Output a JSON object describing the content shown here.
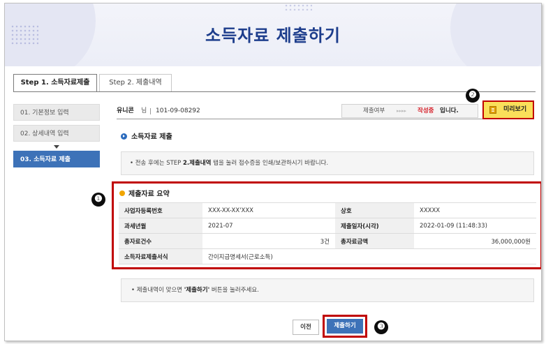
{
  "page": {
    "title": "소득자료 제출하기"
  },
  "tabs": [
    {
      "label": "Step 1. 소득자료제출"
    },
    {
      "label": "Step 2. 제출내역"
    }
  ],
  "sidebar": {
    "items": [
      {
        "label": "01. 기본정보 입력"
      },
      {
        "label": "02. 상세내역 입력"
      },
      {
        "label": "03. 소득자료 제출"
      }
    ]
  },
  "user": {
    "name": "유니콘",
    "suffix": "님",
    "id": "101-09-08292"
  },
  "status": {
    "label": "제출여부",
    "arrows": "▸▸▸▸",
    "value": "작성중",
    "suffix": "입니다."
  },
  "preview_button": "미리보기",
  "markers": [
    "❷",
    "❶",
    "❸"
  ],
  "section": {
    "title": "소득자료 제출"
  },
  "notice1": {
    "prefix": "전송 후에는 STEP ",
    "bold": "2.제출내역",
    "suffix": " 탭을 눌러 접수증을 인쇄/보관하시기 바랍니다."
  },
  "summary": {
    "title": "제출자료 요약",
    "rows": [
      {
        "l1": "사업자등록번호",
        "v1": "XXX-XX-XX'XXX",
        "l2": "상호",
        "v2": "XXXXX"
      },
      {
        "l1": "과세년월",
        "v1": "2021-07",
        "l2": "제출일자(시각)",
        "v2": "2022-01-09 (11:48:33)"
      },
      {
        "l1": "총자료건수",
        "v1": "3건",
        "l2": "총자료금액",
        "v2": "36,000,000원"
      },
      {
        "l1": "소득자료제출서식",
        "v1": "간이지급명세서(근로소득)"
      }
    ]
  },
  "notice2": {
    "prefix": "제출내역이 맞으면 ",
    "bold": "'제출하기'",
    "suffix": " 버튼을 눌러주세요."
  },
  "buttons": {
    "prev": "이전",
    "submit": "제출하기"
  }
}
